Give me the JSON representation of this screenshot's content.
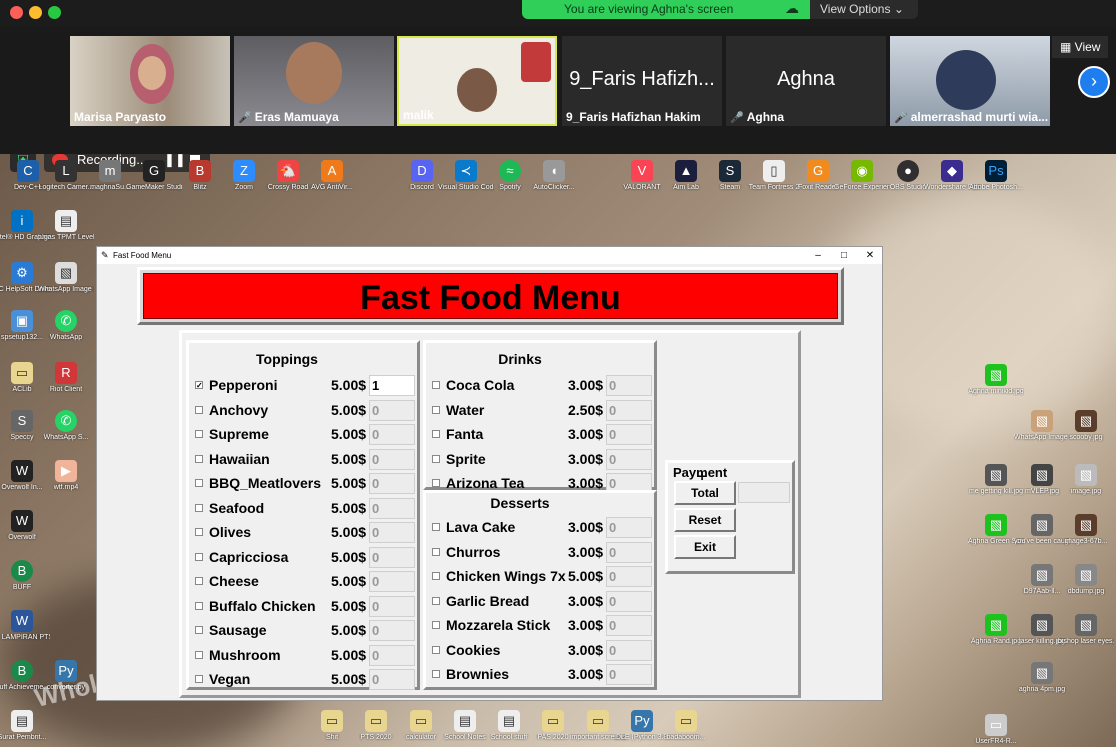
{
  "zoom": {
    "banner_text": "You are viewing Aghna's screen",
    "view_options_label": "View Options ⌄",
    "view_button_label": "View",
    "participants": [
      {
        "name": "Marisa Paryasto",
        "muted": false
      },
      {
        "name": "Eras Mamuaya",
        "muted": true
      },
      {
        "name": "malik",
        "muted": false
      },
      {
        "name": "9_Faris Hafizhan Hakim",
        "muted": true,
        "display": "9_Faris Hafizh..."
      },
      {
        "name": "Aghna",
        "muted": true,
        "display": "Aghna"
      },
      {
        "name": "almerrashad murti wia...",
        "muted": true
      }
    ],
    "recording_label": "Recording..."
  },
  "desktop": {
    "top_icons": [
      "Discord",
      "Visual Studio Code",
      "Spotify",
      "AutoClicker...",
      "VALORANT",
      "Aim Lab",
      "Steam",
      "Team Fortress 2",
      "Foxit Reader",
      "GeForce Experience",
      "OBS Studio",
      "Wondershare Filmora9",
      "Adobe Photosh..."
    ],
    "top_left_icons": [
      "Dev-C++",
      "Logitech Camer...",
      "maghnaSu...",
      "GameMaker Studio 2",
      "Blitz",
      "Zoom",
      "Crossy Road",
      "AVG AntiVir..."
    ],
    "left_icons": [
      "Intel® HD Graphics C...",
      "tugas TPMT Level 3.pdf",
      "PC HelpSoft Driver Up...",
      "WhatsApp Image 2021...",
      "spsetup132...",
      "WhatsApp",
      "ACLib",
      "Riot Client",
      "Speccy",
      "WhatsApp S...",
      "Overwolf In...",
      "wtf.mp4",
      "Overwolf",
      "BUFF",
      "7. LAMPIRAN PTS GANJIL...",
      "Buff Achieveme...",
      "converter.py",
      "Surat Pembrit..."
    ],
    "bottom_icons": [
      "Shit",
      "PTS 2020",
      "calculator",
      "School Notes",
      "School stuff",
      "PAS 2020",
      "important screenshot",
      "IDLE (Python 3.8 32-bit)",
      "badaboom..."
    ],
    "right_icons": [
      "Aghna minikid.jpg",
      "WhatsApp Image 2020...",
      "scooby.jpg",
      "me getting kill.jpg",
      "mVLEP.jpg",
      "image.jpg",
      "Aghna Green Screen.jpg",
      "you've been caught a...",
      "image3-67b...",
      "D97Aab-ll...",
      "dbdump.jpg",
      "Aghna Rand.jpg",
      "laser killing.jpg",
      "bishop laser eyes.jpg",
      "aghna 4pm.jpg",
      "UserFR4-R..."
    ],
    "watermark": "Whole"
  },
  "app": {
    "window_title": "Fast Food Menu",
    "header_title": "Fast Food Menu",
    "toppings": {
      "title": "Toppings",
      "items": [
        {
          "name": "Pepperoni",
          "price": "5.00$",
          "qty": "1",
          "checked": true
        },
        {
          "name": "Anchovy",
          "price": "5.00$",
          "qty": "0",
          "checked": false
        },
        {
          "name": "Supreme",
          "price": "5.00$",
          "qty": "0",
          "checked": false
        },
        {
          "name": "Hawaiian",
          "price": "5.00$",
          "qty": "0",
          "checked": false
        },
        {
          "name": "BBQ_Meatlovers",
          "price": "5.00$",
          "qty": "0",
          "checked": false
        },
        {
          "name": "Seafood",
          "price": "5.00$",
          "qty": "0",
          "checked": false
        },
        {
          "name": "Olives",
          "price": "5.00$",
          "qty": "0",
          "checked": false
        },
        {
          "name": "Capricciosa",
          "price": "5.00$",
          "qty": "0",
          "checked": false
        },
        {
          "name": "Cheese",
          "price": "5.00$",
          "qty": "0",
          "checked": false
        },
        {
          "name": "Buffalo Chicken",
          "price": "5.00$",
          "qty": "0",
          "checked": false
        },
        {
          "name": "Sausage",
          "price": "5.00$",
          "qty": "0",
          "checked": false
        },
        {
          "name": "Mushroom",
          "price": "5.00$",
          "qty": "0",
          "checked": false
        },
        {
          "name": "Vegan",
          "price": "5.00$",
          "qty": "0",
          "checked": false
        }
      ]
    },
    "drinks": {
      "title": "Drinks",
      "items": [
        {
          "name": "Coca Cola",
          "price": "3.00$",
          "qty": "0"
        },
        {
          "name": "Water",
          "price": "2.50$",
          "qty": "0"
        },
        {
          "name": "Fanta",
          "price": "3.00$",
          "qty": "0"
        },
        {
          "name": "Sprite",
          "price": "3.00$",
          "qty": "0"
        },
        {
          "name": "Arizona Tea",
          "price": "3.00$",
          "qty": "0"
        }
      ]
    },
    "desserts": {
      "title": "Desserts",
      "items": [
        {
          "name": "Lava Cake",
          "price": "3.00$",
          "qty": "0"
        },
        {
          "name": "Churros",
          "price": "3.00$",
          "qty": "0"
        },
        {
          "name": "Chicken Wings 7x",
          "price": "5.00$",
          "qty": "0"
        },
        {
          "name": "Garlic Bread",
          "price": "3.00$",
          "qty": "0"
        },
        {
          "name": "Mozzarela Stick",
          "price": "3.00$",
          "qty": "0"
        },
        {
          "name": "Cookies",
          "price": "3.00$",
          "qty": "0"
        },
        {
          "name": "Brownies",
          "price": "3.00$",
          "qty": "0"
        }
      ]
    },
    "payment": {
      "title": "Payment",
      "total_label": "Total",
      "reset_label": "Reset",
      "exit_label": "Exit"
    }
  }
}
